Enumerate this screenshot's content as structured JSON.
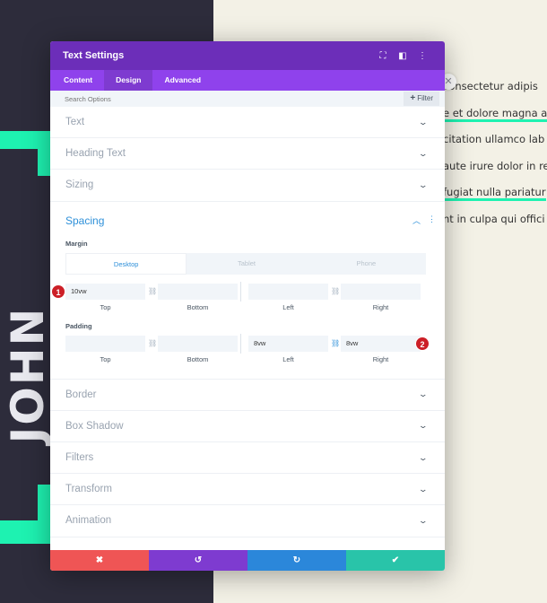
{
  "background": {
    "vertical_name": "JOHN DOE",
    "body_lines": [
      "consectetur adipis",
      "e et dolore magna a",
      "citation ullamco lab",
      "aute irure dolor in re",
      "fugiat nulla pariatur",
      "nt in culpa qui offici"
    ],
    "colors": {
      "dark_panel": "#2d2c3b",
      "accent": "#1ef2b1",
      "page": "#f3f1e6"
    }
  },
  "modal": {
    "title": "Text Settings",
    "header_icons": [
      "fullscreen-icon",
      "sidebar-icon",
      "more-icon"
    ],
    "tabs": [
      {
        "label": "Content",
        "active": false
      },
      {
        "label": "Design",
        "active": true
      },
      {
        "label": "Advanced",
        "active": false
      }
    ],
    "search": {
      "placeholder": "Search Options"
    },
    "filter_label": "Filter",
    "sections_top": [
      "Text",
      "Heading Text",
      "Sizing"
    ],
    "spacing": {
      "title": "Spacing",
      "margin": {
        "label": "Margin",
        "devices": [
          "Desktop",
          "Tablet",
          "Phone"
        ],
        "active_device": "Desktop",
        "fields": [
          {
            "caption": "Top",
            "value": "10vw"
          },
          {
            "caption": "Bottom",
            "value": ""
          },
          {
            "caption": "Left",
            "value": ""
          },
          {
            "caption": "Right",
            "value": ""
          }
        ],
        "badge": "1"
      },
      "padding": {
        "label": "Padding",
        "fields": [
          {
            "caption": "Top",
            "value": ""
          },
          {
            "caption": "Bottom",
            "value": ""
          },
          {
            "caption": "Left",
            "value": "8vw"
          },
          {
            "caption": "Right",
            "value": "8vw"
          }
        ],
        "badge": "2"
      }
    },
    "sections_bottom": [
      "Border",
      "Box Shadow",
      "Filters",
      "Transform",
      "Animation"
    ],
    "footer": {
      "cancel_icon": "✖",
      "undo_icon": "↺",
      "redo_icon": "↻",
      "save_icon": "✔"
    },
    "colors": {
      "header": "#6c2eb9",
      "tabs": "#8f42ec",
      "link": "#2e90d9",
      "badge": "#cc1f27"
    }
  }
}
